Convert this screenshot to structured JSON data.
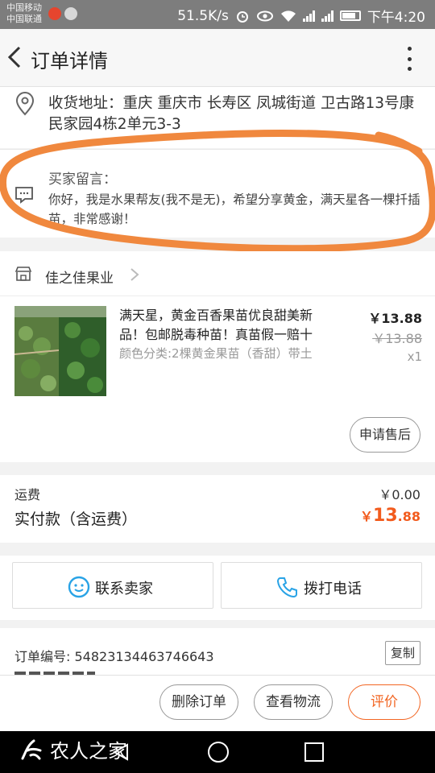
{
  "status_bar": {
    "carrier_1": "中国移动",
    "carrier_2": "中国联通",
    "network_speed": "51.5K/s",
    "time": "下午4:20"
  },
  "header": {
    "title": "订单详情"
  },
  "address": {
    "text": "收货地址：重庆 重庆市 长寿区 凤城街道 卫古路13号康民家园4栋2单元3-3"
  },
  "remark": {
    "title": "买家留言：",
    "text": "你好，我是水果帮友(我不是无)，希望分享黄金，满天星各一棵扦插苗，非常感谢！"
  },
  "shop": {
    "name": "佳之佳果业"
  },
  "product": {
    "title": "满天星，黄金百香果苗优良甜美新品！包邮脱毒种苗！真苗假一赔十",
    "spec": "颜色分类:2棵黄金果苗（香甜）带土",
    "price": "￥13.88",
    "original_price": "￥13.88",
    "quantity": "x1",
    "aftersale_label": "申请售后"
  },
  "fees": {
    "shipping_label": "运费",
    "shipping_value": "￥0.00",
    "paid_label": "实付款（含运费）",
    "paid_currency": "￥",
    "paid_integer": "13",
    "paid_decimal": ".88"
  },
  "contact": {
    "seller_label": "联系卖家",
    "phone_label": "拨打电话"
  },
  "order": {
    "number_label": "订单编号:  54823134463746643",
    "copy_label": "复制"
  },
  "actions": {
    "delete_label": "删除订单",
    "logistics_label": "查看物流",
    "review_label": "评价"
  },
  "watermark": {
    "text": "农人之家"
  },
  "colors": {
    "accent": "#f26522",
    "highlight_ring": "#f0883e",
    "price_red": "#f25b1d",
    "contact_blue": "#29a3e6"
  }
}
